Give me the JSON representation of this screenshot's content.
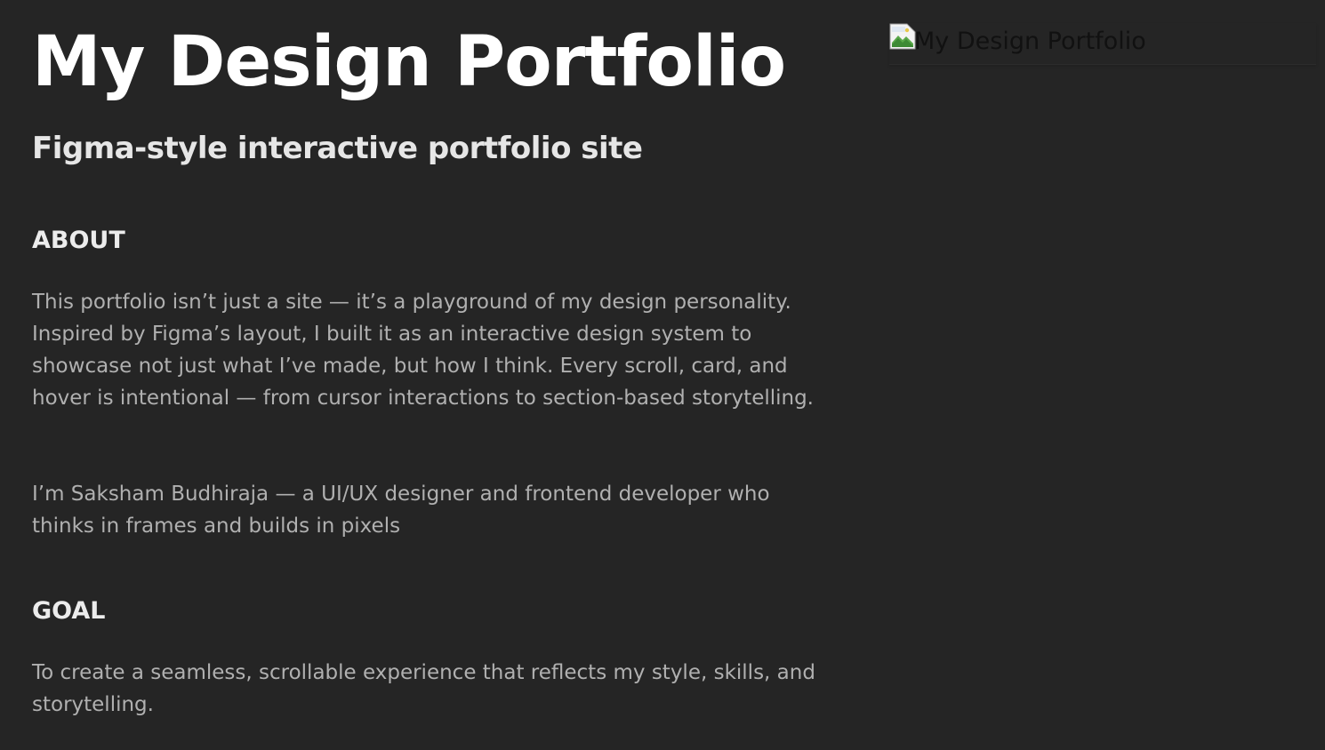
{
  "page": {
    "title": "My Design Portfolio",
    "subtitle": "Figma-style interactive portfolio site"
  },
  "about": {
    "heading": "ABOUT",
    "paragraph_1": "This portfolio isn’t just a site — it’s a playground of my design personality. Inspired by Figma’s layout, I built it as an interactive design system to showcase not just what I’ve made, but how I think. Every scroll, card, and hover is intentional — from cursor interactions to section-based storytelling.",
    "paragraph_2": "I’m Saksham Budhiraja — a UI/UX designer and frontend developer who thinks in frames and builds in pixels"
  },
  "goal": {
    "heading": "GOAL",
    "paragraph": "To create a seamless, scrollable experience that reflects my style, skills, and storytelling."
  },
  "hero_image": {
    "alt": "My Design Portfolio",
    "icon": "broken-image-icon"
  },
  "colors": {
    "background": "#252525",
    "title": "#ffffff",
    "body_text": "#b0b0b0"
  }
}
